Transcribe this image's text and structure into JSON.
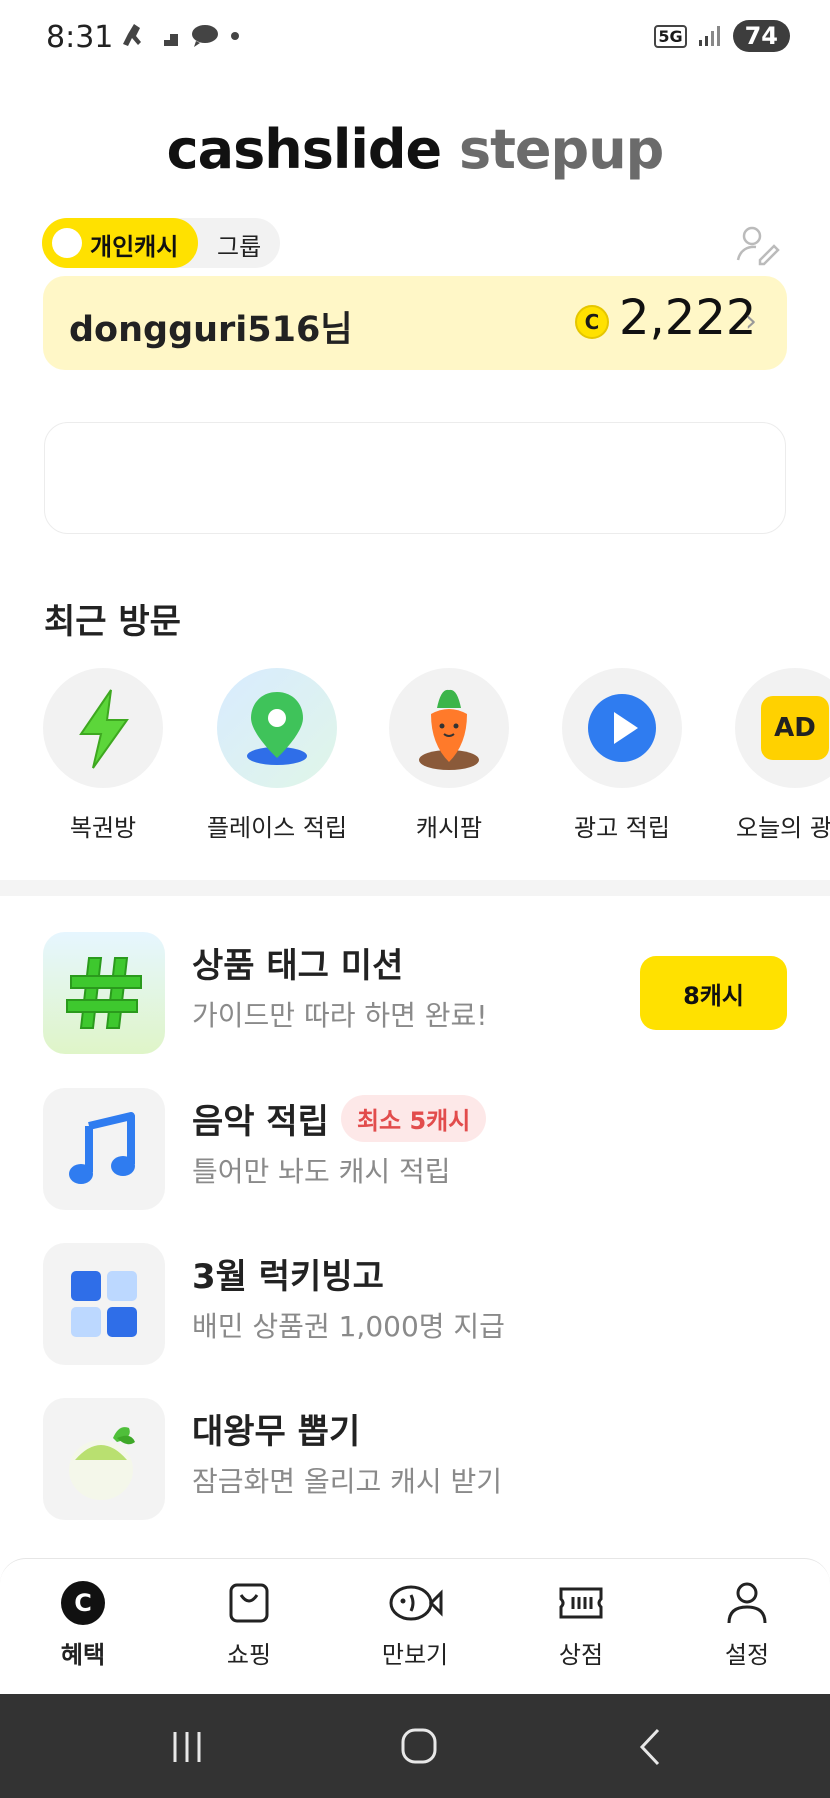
{
  "status_bar": {
    "time": "8:31",
    "network": "5G",
    "battery": "74"
  },
  "logo": {
    "part1": "cashslide",
    "part2": "stepup"
  },
  "toggle": {
    "personal": "개인캐시",
    "group": "그룹"
  },
  "account": {
    "name": "dongguri516님",
    "coin_symbol": "C",
    "balance": "2,222",
    "chevron": "›"
  },
  "recent": {
    "title": "최근 방문",
    "items": [
      {
        "label": "복권방",
        "icon": "lightning-icon"
      },
      {
        "label": "플레이스 적립",
        "icon": "map-pin-icon"
      },
      {
        "label": "캐시팜",
        "icon": "carrot-icon"
      },
      {
        "label": "광고 적립",
        "icon": "play-icon"
      },
      {
        "label": "오늘의 광고",
        "icon": "ad-icon",
        "ad_text": "AD"
      }
    ]
  },
  "missions": [
    {
      "title": "상품 태그 미션",
      "desc": "가이드만 따라 하면 완료!",
      "button": "8캐시"
    },
    {
      "title": "음악 적립",
      "badge": "최소 5캐시",
      "desc": "틀어만 놔도 캐시 적립"
    },
    {
      "title": "3월 럭키빙고",
      "desc": "배민 상품권 1,000명 지급"
    },
    {
      "title": "대왕무 뽑기",
      "desc": "잠금화면 올리고 캐시 받기"
    }
  ],
  "nav": {
    "items": [
      {
        "label": "혜택",
        "icon": "cash-c-icon",
        "active": true
      },
      {
        "label": "쇼핑",
        "icon": "shopping-bag-icon"
      },
      {
        "label": "만보기",
        "icon": "fish-icon"
      },
      {
        "label": "상점",
        "icon": "ticket-icon"
      },
      {
        "label": "설정",
        "icon": "person-icon"
      }
    ]
  },
  "colors": {
    "accent": "#ffe100",
    "card_bg": "#fff7c7",
    "badge_red": "#e24c4c"
  }
}
